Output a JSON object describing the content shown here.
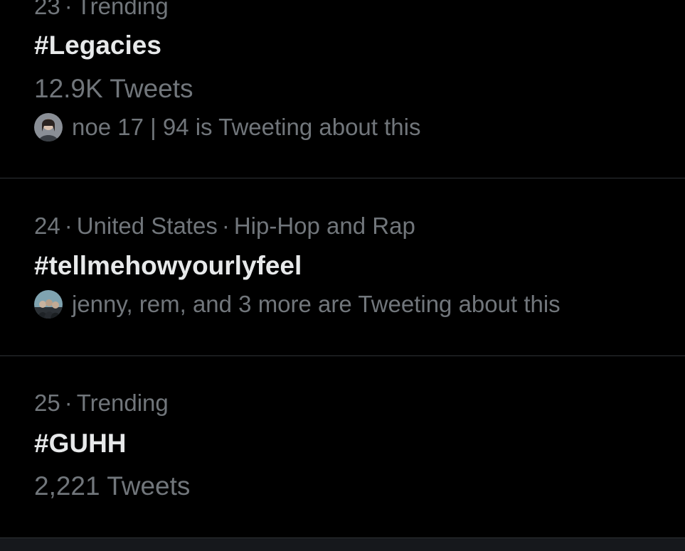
{
  "trends": [
    {
      "rank": "23",
      "context": [
        "Trending"
      ],
      "hashtag": "#Legacies",
      "tweet_count": "12.9K Tweets",
      "social": "noe 17 | 94 is Tweeting about this",
      "avatar_icon": "user-avatar-icon"
    },
    {
      "rank": "24",
      "context": [
        "United States",
        "Hip-Hop and Rap"
      ],
      "hashtag": "#tellmehowyourlyfeel",
      "social": "jenny, rem, and 3 more are Tweeting about this",
      "avatar_icon": "group-avatar-icon"
    },
    {
      "rank": "25",
      "context": [
        "Trending"
      ],
      "hashtag": "#GUHH",
      "tweet_count": "2,221 Tweets"
    }
  ],
  "separator": "·",
  "colors": {
    "background": "#000000",
    "primary_text": "#e7e9ea",
    "secondary_text": "#71767b",
    "divider": "#2f3336"
  }
}
